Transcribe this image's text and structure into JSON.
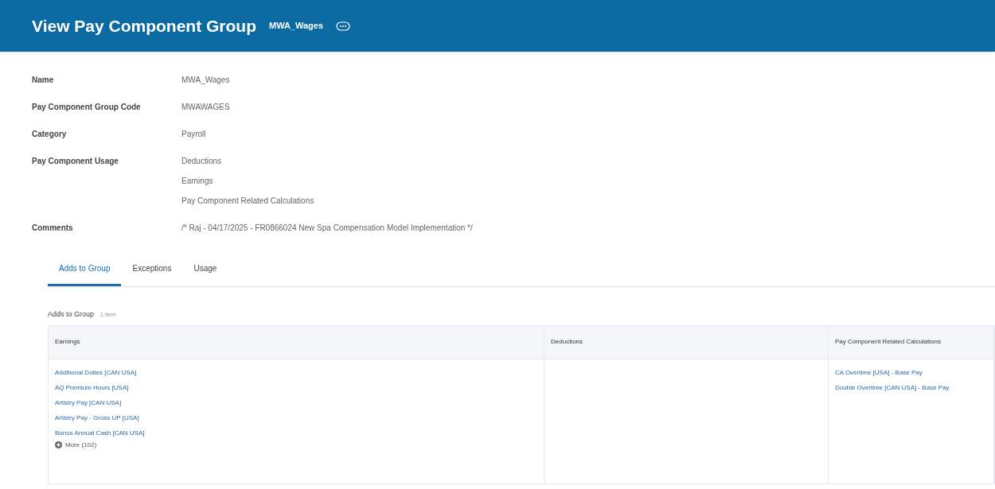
{
  "header": {
    "title": "View Pay Component Group",
    "subtitle": "MWA_Wages"
  },
  "fields": [
    {
      "label": "Name",
      "values": [
        "MWA_Wages"
      ]
    },
    {
      "label": "Pay Component Group Code",
      "values": [
        "MWAWAGES"
      ]
    },
    {
      "label": "Category",
      "values": [
        "Payroll"
      ]
    },
    {
      "label": "Pay Component Usage",
      "values": [
        "Deductions",
        "Earnings",
        "Pay Component Related Calculations"
      ]
    },
    {
      "label": "Comments",
      "values": [
        "/* Raj - 04/17/2025 - FR0866024 New Spa Compensation Model Implementation */"
      ]
    }
  ],
  "tabs": [
    {
      "label": "Adds to Group",
      "selected": true
    },
    {
      "label": "Exceptions",
      "selected": false
    },
    {
      "label": "Usage",
      "selected": false
    }
  ],
  "table": {
    "title": "Adds to Group",
    "count": "1 item",
    "columns": [
      "Earnings",
      "Deductions",
      "Pay Component Related Calculations"
    ],
    "cells": [
      [
        "Additional Duties [CAN USA]",
        "AQ Premium Hours [USA]",
        "Artistry Pay [CAN USA]",
        "Artistry Pay - Gross UP [USA]",
        "Bonus Annual Cash [CAN USA]"
      ],
      [],
      [
        "CA Overtime [USA] - Base Pay",
        "Double Overtime [CAN USA] - Base Pay"
      ]
    ],
    "more": "More (102)"
  }
}
